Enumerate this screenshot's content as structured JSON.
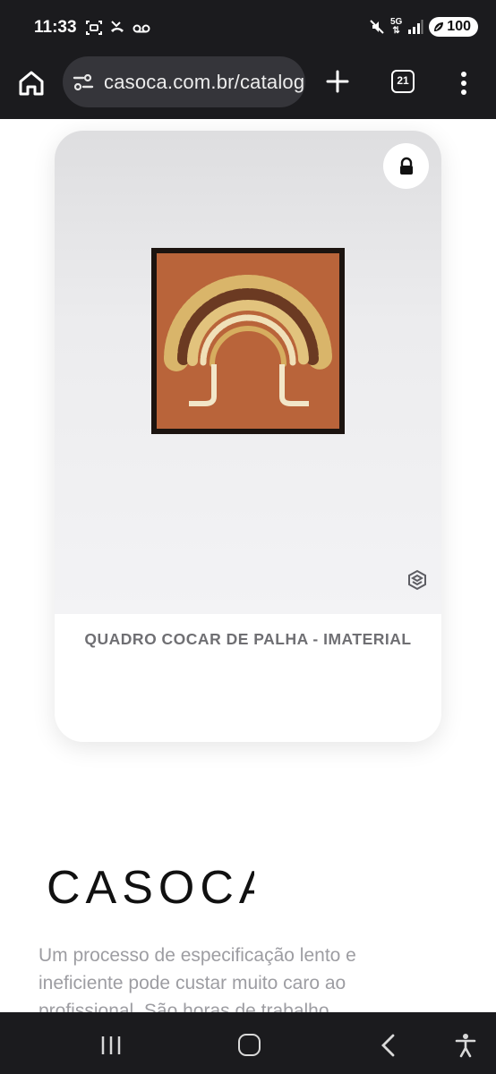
{
  "status_bar": {
    "time": "11:33",
    "network": "5G",
    "battery": "100"
  },
  "browser": {
    "url": "casoca.com.br/catalogo",
    "tab_count": "21"
  },
  "product": {
    "title": "QUADRO COCAR DE PALHA - IMATERIAL"
  },
  "brand": {
    "name": "CASOCA"
  },
  "intro": {
    "text": "Um processo de especificação lento e ineficiente pode custar muito caro ao profissional. São horas de trabalho"
  },
  "colors": {
    "system_bar": "#1b1b1e",
    "url_bar": "#35353a",
    "title_text": "#6f6f73",
    "intro_text": "#9d9da2",
    "frame_background": "#b9643a"
  }
}
